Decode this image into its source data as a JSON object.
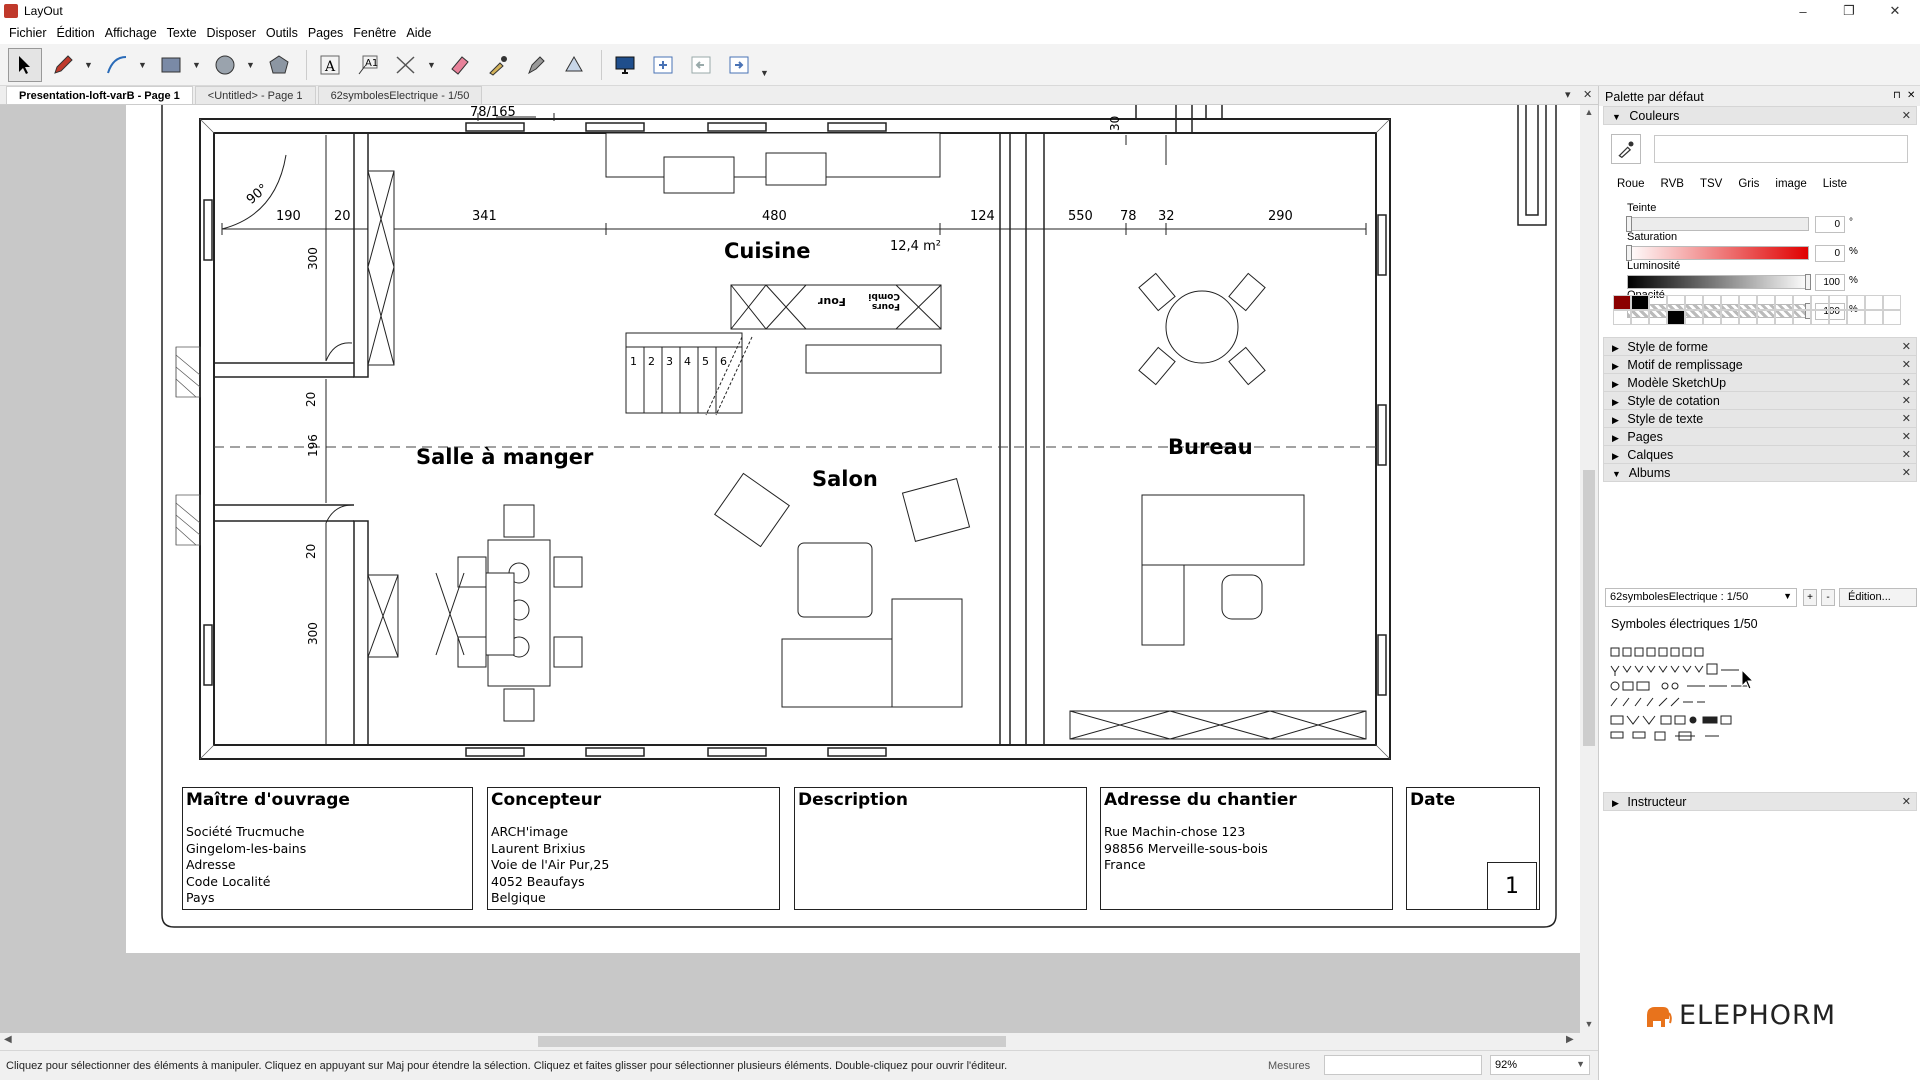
{
  "window": {
    "title": "LayOut",
    "minimize": "–",
    "restore": "❐",
    "close": "✕"
  },
  "menu": [
    "Fichier",
    "Édition",
    "Affichage",
    "Texte",
    "Disposer",
    "Outils",
    "Pages",
    "Fenêtre",
    "Aide"
  ],
  "tabs": [
    {
      "label": "Presentation-loft-varB - Page 1",
      "active": true
    },
    {
      "label": "<Untitled> - Page 1",
      "active": false
    },
    {
      "label": "62symbolesElectrique - 1/50",
      "active": false
    }
  ],
  "tabctl": {
    "dropdown": "▾",
    "close": "✕"
  },
  "plan": {
    "rooms": {
      "cuisine": "Cuisine",
      "salle": "Salle à manger",
      "salon": "Salon",
      "bureau": "Bureau"
    },
    "area": "12,4 m²",
    "angle": "90°",
    "dims_top": [
      "190",
      "20",
      "341",
      "480",
      "124",
      "550",
      "78",
      "32",
      "290"
    ],
    "dim_top_small": "78/165",
    "dims_left": [
      "300",
      "20",
      "196",
      "20",
      "300"
    ],
    "dim_30": "30",
    "stairs": [
      "1",
      "2",
      "3",
      "4",
      "5",
      "6"
    ],
    "appliance_four": "Four",
    "appliance_combi": "Fours Combi"
  },
  "titleblock": {
    "maitre": {
      "title": "Maître d'ouvrage",
      "lines": [
        "Société Trucmuche",
        "Gingelom-les-bains",
        "Adresse",
        "Code Localité",
        "Pays"
      ]
    },
    "concepteur": {
      "title": "Concepteur",
      "lines": [
        "ARCH'image",
        "Laurent Brixius",
        "Voie de l'Air Pur,25",
        "4052 Beaufays",
        "Belgique"
      ]
    },
    "description": {
      "title": "Description"
    },
    "adresse": {
      "title": "Adresse du chantier",
      "lines": [
        "Rue Machin-chose 123",
        "98856 Merveille-sous-bois",
        "France"
      ]
    },
    "date": {
      "title": "Date"
    },
    "page_number": "1"
  },
  "status": {
    "hint": "Cliquez pour sélectionner des éléments à manipuler. Cliquez en appuyant sur Maj pour étendre la sélection. Cliquez et faites glisser pour sélectionner plusieurs éléments. Double-cliquez pour ouvrir l'éditeur.",
    "measure_label": "Mesures",
    "zoom": "92%"
  },
  "panel": {
    "title": "Palette par défaut",
    "pin": "⊓",
    "close": "✕",
    "colors": {
      "section": "Couleurs",
      "tabs": [
        "Roue",
        "RVB",
        "TSV",
        "Gris",
        "image",
        "Liste"
      ],
      "active_tab": "TSV",
      "sliders": [
        {
          "label": "Teinte",
          "value": "0",
          "unit": "°"
        },
        {
          "label": "Saturation",
          "value": "0",
          "unit": "%"
        },
        {
          "label": "Luminosité",
          "value": "100",
          "unit": "%"
        },
        {
          "label": "Opacité",
          "value": "100",
          "unit": "%"
        }
      ],
      "swatch_colors": [
        "#8b0000",
        "#000000"
      ],
      "swatch_black2": "#000000"
    },
    "sections": [
      "Style de forme",
      "Motif de remplissage",
      "Modèle SketchUp",
      "Style de cotation",
      "Style de texte",
      "Pages",
      "Calques"
    ],
    "albums": {
      "section": "Albums",
      "selected": "62symbolesElectrique : 1/50",
      "add": "+",
      "remove": "-",
      "edit": "Édition...",
      "name": "Symboles électriques 1/50"
    },
    "instructeur": "Instructeur",
    "brand": "ELEPHORM",
    "brand_color": "#e8731c"
  }
}
